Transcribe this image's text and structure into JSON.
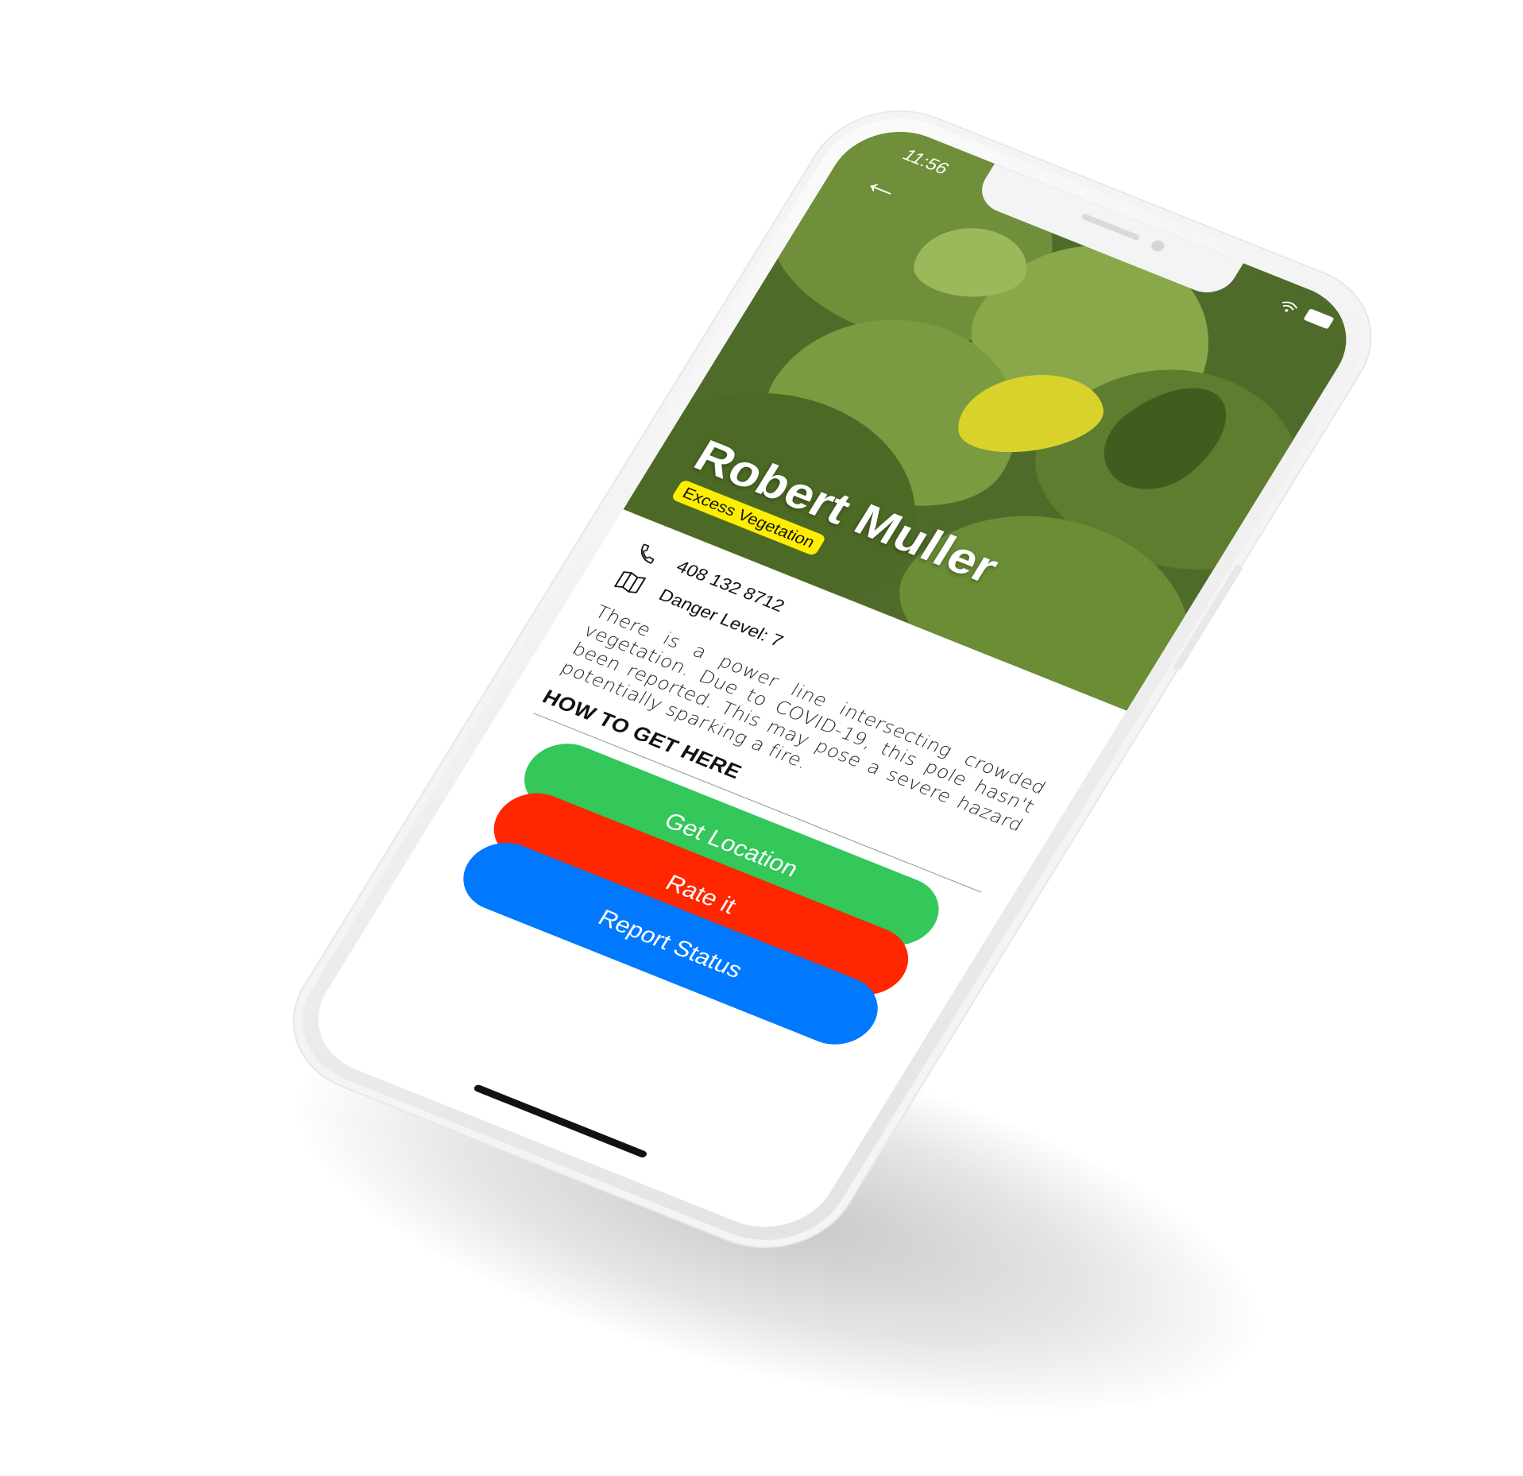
{
  "status_bar": {
    "time": "11:56",
    "signal": "wifi"
  },
  "hero": {
    "name": "Robert Muller",
    "badge": "Excess Vegetation"
  },
  "info": {
    "phone": "408 132 8712",
    "danger": "Danger Level: 7"
  },
  "description": "There is a power line intersecting crowded vegetation. Due to COVID-19, this pole hasn't been reported. This may pose a severe hazard potentially sparking a fire.",
  "how_to": "HOW TO GET HERE",
  "buttons": {
    "get_location": "Get Location",
    "rate_it": "Rate it",
    "report_status": "Report Status"
  },
  "colors": {
    "green": "#34c759",
    "red": "#ff2600",
    "blue": "#0079ff",
    "badge": "#ffee00"
  },
  "icons": {
    "back": "back-arrow-icon",
    "phone": "phone-icon",
    "map": "map-icon"
  }
}
